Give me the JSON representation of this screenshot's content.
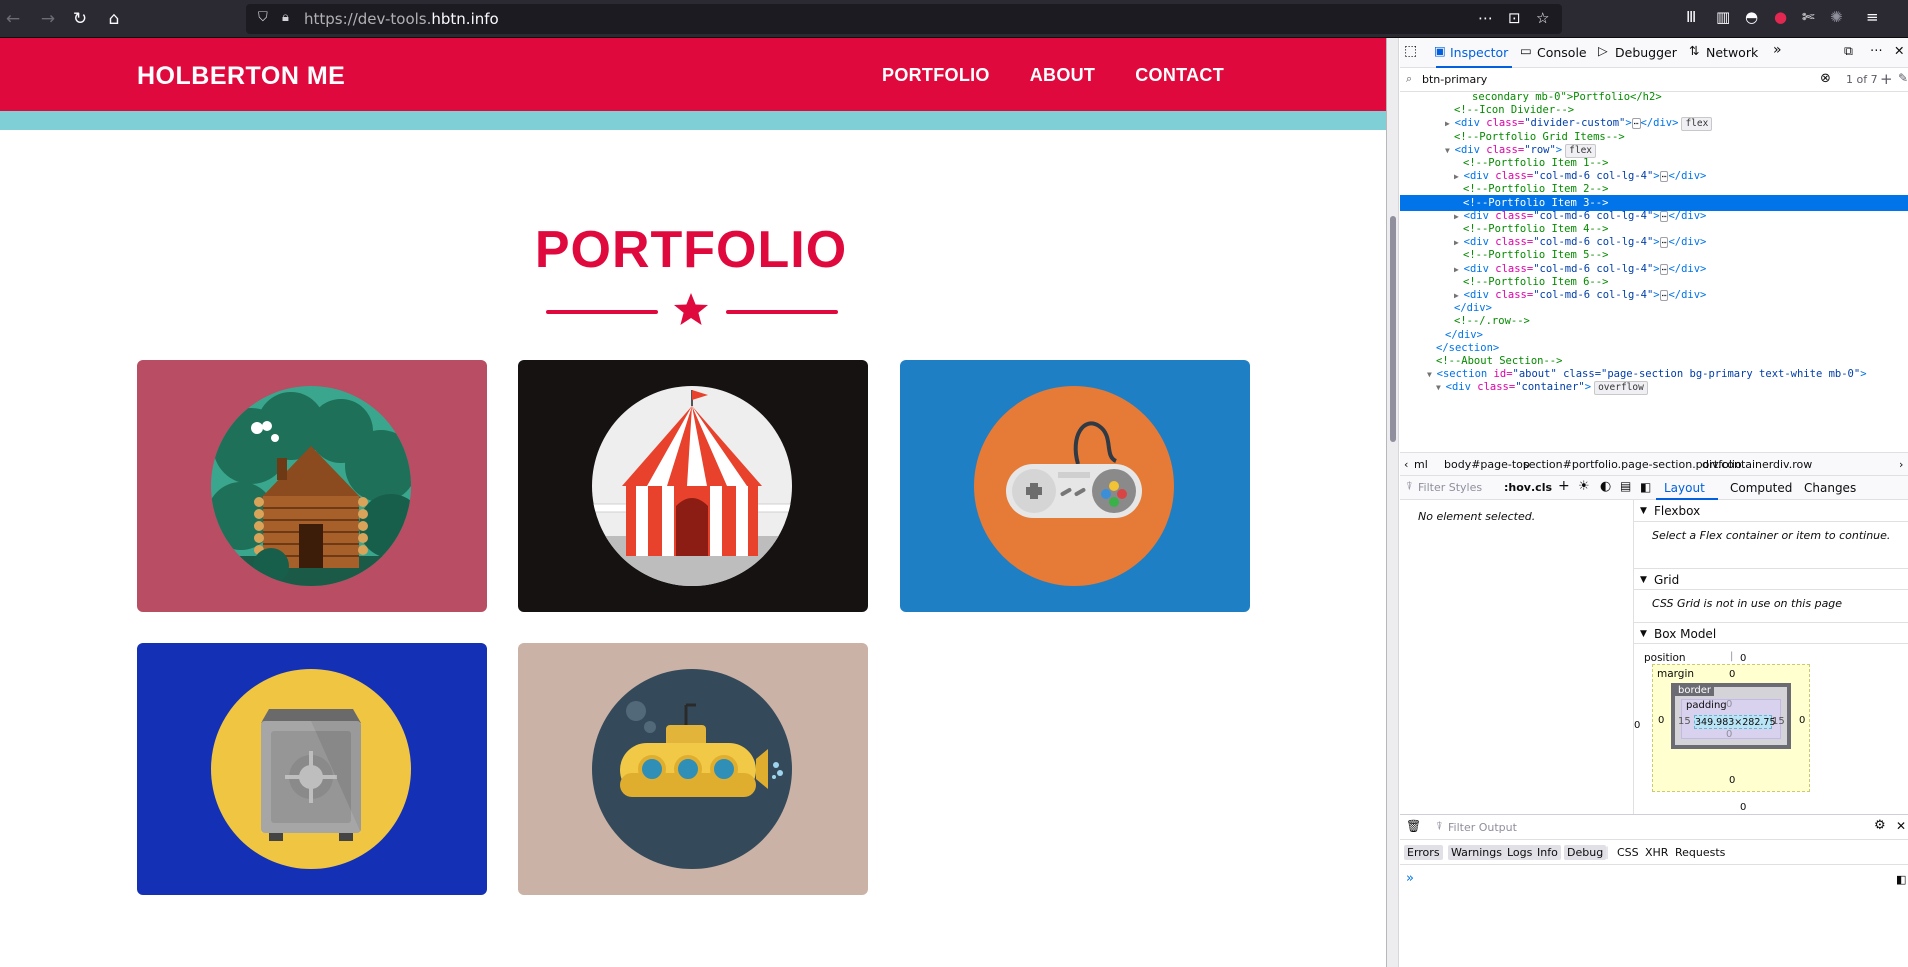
{
  "browser": {
    "url_prefix": "https://dev-tools.",
    "url_domain": "hbtn.info"
  },
  "site": {
    "brand": "HOLBERTON ME",
    "nav": [
      "PORTFOLIO",
      "ABOUT",
      "CONTACT"
    ],
    "section_title": "PORTFOLIO",
    "colors": {
      "primary": "#e0093d",
      "teal": "#7ecfd6"
    },
    "portfolio_items": [
      {
        "icon": "cabin-icon",
        "bg": "#b94d63"
      },
      {
        "icon": "circus-tent-icon",
        "bg": "#161211"
      },
      {
        "icon": "game-controller-icon",
        "bg": "#1e7fc4"
      },
      {
        "icon": "safe-icon",
        "bg": "#1431b5"
      },
      {
        "icon": "submarine-icon",
        "bg": "#cab2a6"
      }
    ]
  },
  "devtools": {
    "tabs": [
      "Inspector",
      "Console",
      "Debugger",
      "Network"
    ],
    "search_query": "btn-primary",
    "search_count": "1 of 7",
    "markup_lines": [
      {
        "indent": 8,
        "type": "cmt",
        "text": "secondary mb-0\">Portfolio</h2>"
      },
      {
        "indent": 6,
        "type": "cmt",
        "text": "<!--Icon Divider-->"
      },
      {
        "indent": 5,
        "type": "tag",
        "tri": "▶",
        "tag": "<div ",
        "attr": "class=",
        "val": "\"divider-custom\"",
        "end": "> </div>",
        "badge": "flex",
        "dots": true
      },
      {
        "indent": 6,
        "type": "cmt",
        "text": "<!--Portfolio Grid Items-->"
      },
      {
        "indent": 5,
        "type": "tag",
        "tri": "▼",
        "tag": "<div ",
        "attr": "class=",
        "val": "\"row\"",
        "end": ">",
        "badge": "flex"
      },
      {
        "indent": 7,
        "type": "cmt",
        "text": "<!--Portfolio Item 1-->"
      },
      {
        "indent": 6,
        "type": "tag",
        "tri": "▶",
        "tag": "<div ",
        "attr": "class=",
        "val": "\"col-md-6 col-lg-4\"",
        "end": "> </div>",
        "dots": true
      },
      {
        "indent": 7,
        "type": "cmt",
        "text": "<!--Portfolio Item 2-->"
      },
      {
        "indent": 7,
        "type": "cmt",
        "text": "<!--Portfolio Item 3-->",
        "selected": true
      },
      {
        "indent": 6,
        "type": "tag",
        "tri": "▶",
        "tag": "<div ",
        "attr": "class=",
        "val": "\"col-md-6 col-lg-4\"",
        "end": "> </div>",
        "dots": true
      },
      {
        "indent": 7,
        "type": "cmt",
        "text": "<!--Portfolio Item 4-->"
      },
      {
        "indent": 6,
        "type": "tag",
        "tri": "▶",
        "tag": "<div ",
        "attr": "class=",
        "val": "\"col-md-6 col-lg-4\"",
        "end": "> </div>",
        "dots": true
      },
      {
        "indent": 7,
        "type": "cmt",
        "text": "<!--Portfolio Item 5-->"
      },
      {
        "indent": 6,
        "type": "tag",
        "tri": "▶",
        "tag": "<div ",
        "attr": "class=",
        "val": "\"col-md-6 col-lg-4\"",
        "end": "> </div>",
        "dots": true
      },
      {
        "indent": 7,
        "type": "cmt",
        "text": "<!--Portfolio Item 6-->"
      },
      {
        "indent": 6,
        "type": "tag",
        "tri": "▶",
        "tag": "<div ",
        "attr": "class=",
        "val": "\"col-md-6 col-lg-4\"",
        "end": "> </div>",
        "dots": true
      },
      {
        "indent": 6,
        "type": "tag",
        "tag": "</div>"
      },
      {
        "indent": 6,
        "type": "cmt",
        "text": "<!--/.row-->"
      },
      {
        "indent": 5,
        "type": "tag",
        "tag": "</div>"
      },
      {
        "indent": 4,
        "type": "tag",
        "tag": "</section>"
      },
      {
        "indent": 4,
        "type": "cmt",
        "text": "<!--About Section-->"
      },
      {
        "indent": 3,
        "type": "tag",
        "tri": "▼",
        "tag": "<section ",
        "attr": "id=",
        "val": "\"about\" class=\"page-section bg-primary text-white mb-0\"",
        "end": ">"
      },
      {
        "indent": 4,
        "type": "tag",
        "tri": "▼",
        "tag": "<div ",
        "attr": "class=",
        "val": "\"container\"",
        "end": ">",
        "badge": "overflow"
      }
    ],
    "breadcrumbs": [
      "ml",
      "body#page-top",
      "section#portfolio.page-section.portfolio",
      "div.container",
      "div.row"
    ],
    "rules_filter_placeholder": "Filter Styles",
    "rules_hov": ":hov",
    "rules_cls": ".cls",
    "no_element": "No element selected.",
    "layout_tabs": [
      "Layout",
      "Computed",
      "Changes"
    ],
    "flexbox_title": "Flexbox",
    "flexbox_text": "Select a Flex container or item to continue.",
    "grid_title": "Grid",
    "grid_text": "CSS Grid is not in use on this page",
    "boxmodel_title": "Box Model",
    "boxmodel": {
      "position_label": "position",
      "margin_label": "margin",
      "border_label": "border",
      "padding_label": "padding",
      "content_size": "349.983×282.75",
      "zero": "0",
      "padding_side": "15"
    },
    "console_filter_placeholder": "Filter Output",
    "console_filters": [
      "Errors",
      "Warnings",
      "Logs",
      "Info",
      "Debug",
      "CSS",
      "XHR",
      "Requests"
    ],
    "console_prompt": "»"
  }
}
